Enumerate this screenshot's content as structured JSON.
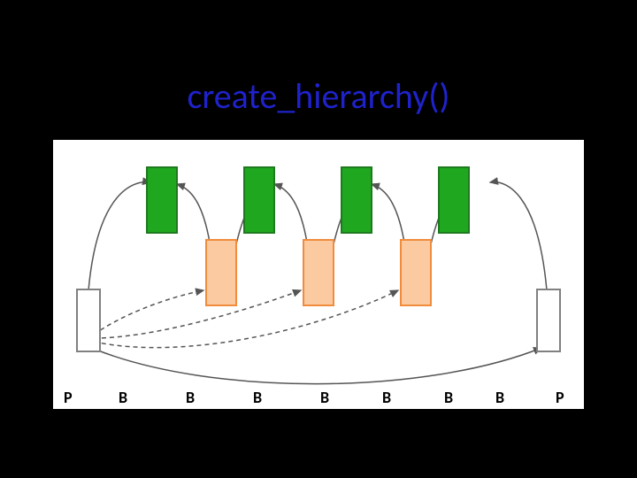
{
  "title": "create_hierarchy()",
  "colors": {
    "title": "#1f22cc",
    "green": "#1fa81f",
    "orange": "#fbcaa1",
    "orange_border": "#f08c3c",
    "gray_border": "#808080"
  },
  "diagram": {
    "green_boxes": 4,
    "orange_boxes": 3,
    "gray_boxes": 2,
    "labels": [
      "P",
      "B",
      "B",
      "B",
      "B",
      "B",
      "B",
      "B",
      "P"
    ]
  }
}
